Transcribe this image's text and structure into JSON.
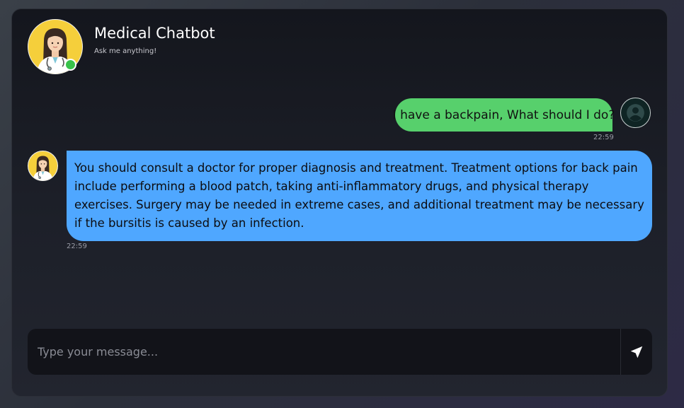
{
  "header": {
    "title": "Medical Chatbot",
    "subtitle": "Ask me anything!",
    "avatar_icon": "doctor-avatar-icon",
    "status": "online"
  },
  "messages": [
    {
      "sender": "user",
      "text": "I have a backpain, What should I do?",
      "time": "22:59",
      "avatar_icon": "user-icon"
    },
    {
      "sender": "bot",
      "text": "You should consult a doctor for proper diagnosis and treatment. Treatment options for back pain include performing a blood patch, taking anti-inflammatory drugs, and physical therapy exercises. Surgery may be needed in extreme cases, and additional treatment may be necessary if the bursitis is caused by an infection.",
      "time": "22:59",
      "avatar_icon": "doctor-avatar-icon"
    }
  ],
  "input": {
    "placeholder": "Type your message...",
    "value": "",
    "send_icon": "send-arrow-icon"
  },
  "colors": {
    "user_bubble": "#57d06c",
    "bot_bubble": "#4fa7ff",
    "online": "#38c24a",
    "avatar_bg": "#f5cf3b"
  }
}
